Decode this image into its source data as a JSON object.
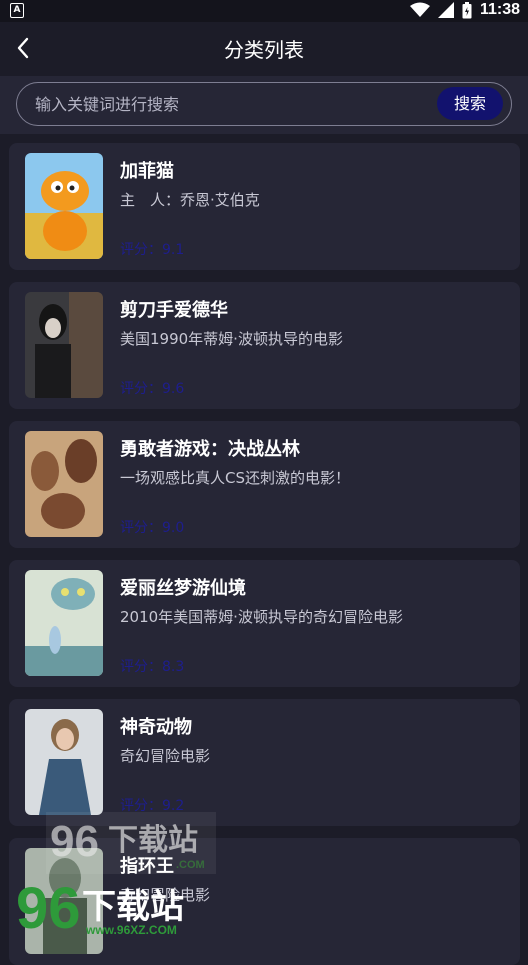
{
  "status_bar": {
    "time": "11:38",
    "notification_icon_letter": "A"
  },
  "header": {
    "title": "分类列表"
  },
  "search": {
    "placeholder": "输入关键词进行搜索",
    "value": "",
    "button_label": "搜索"
  },
  "movies": [
    {
      "title": "加菲猫",
      "description": "主　人：乔恩·艾伯克",
      "score": "评分：9.1",
      "poster_colors": [
        "#f39a1e",
        "#8cc8ee"
      ]
    },
    {
      "title": "剪刀手爱德华",
      "description": "美国1990年蒂姆·波顿执导的电影",
      "score": "评分：9.6",
      "poster_colors": [
        "#2a2a2e",
        "#5a4a3e"
      ]
    },
    {
      "title": "勇敢者游戏：决战丛林",
      "description": "一场观感比真人CS还刺激的电影！",
      "score": "评分：9.0",
      "poster_colors": [
        "#8a5a3a",
        "#c8a47c"
      ]
    },
    {
      "title": "爱丽丝梦游仙境",
      "description": "2010年美国蒂姆·波顿执导的奇幻冒险电影",
      "score": "评分：8.3",
      "poster_colors": [
        "#7fb0b8",
        "#d8e2d4"
      ]
    },
    {
      "title": "神奇动物",
      "description": "奇幻冒险电影",
      "score": "评分：9.2",
      "poster_colors": [
        "#3a5a7a",
        "#8a6a4a"
      ]
    },
    {
      "title": "指环王",
      "description": "奇幻冒险电影",
      "score": "",
      "poster_colors": [
        "#6a7a6a",
        "#aab4aa"
      ]
    }
  ],
  "watermark": {
    "text": "下载站",
    "number": "96",
    "url": "www.96XZ.COM",
    "domain_part": ".COM"
  },
  "colors": {
    "background": "#1c1c28",
    "card": "#262636",
    "accent": "#12126e",
    "score": "#1e1e8c"
  }
}
